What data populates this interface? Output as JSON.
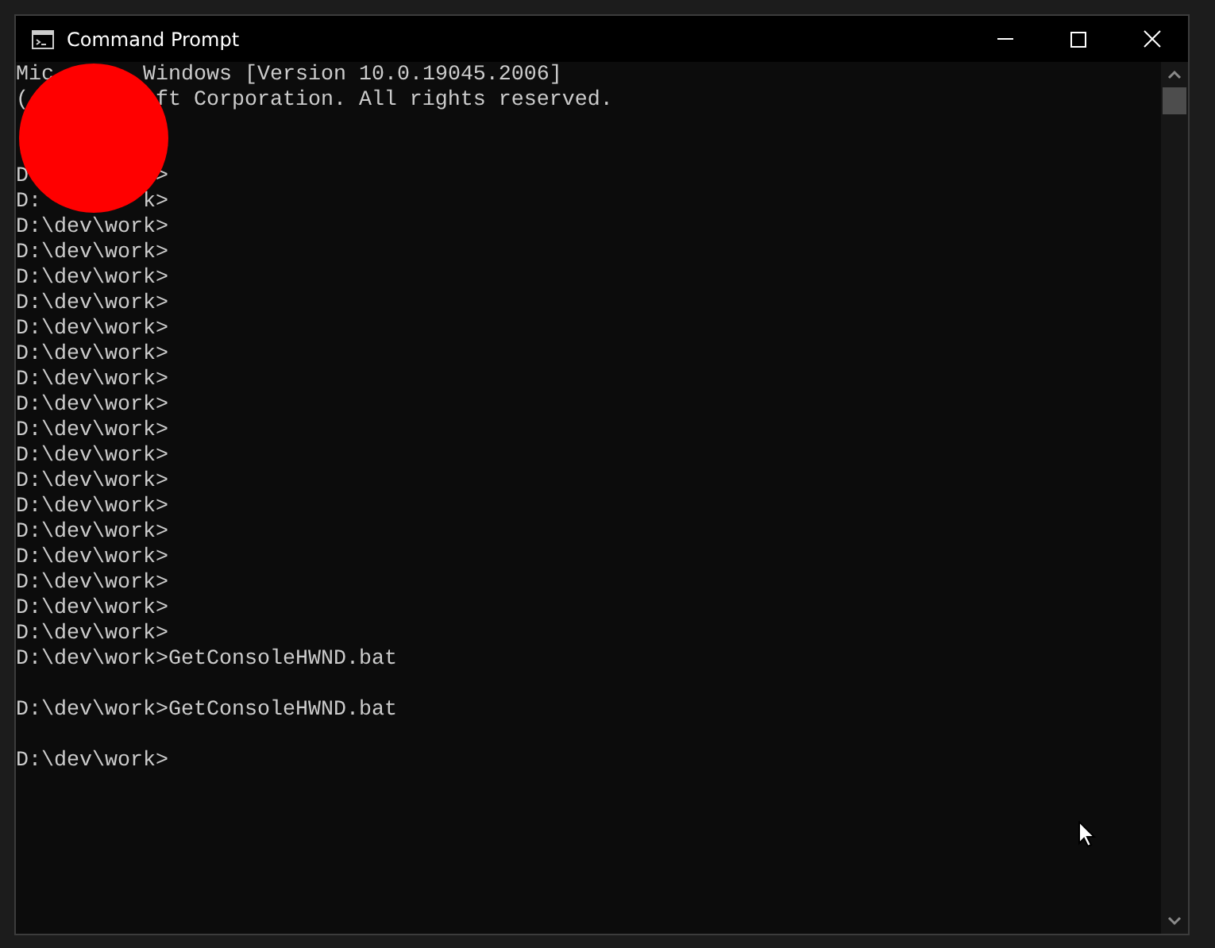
{
  "window": {
    "title": "Command Prompt"
  },
  "console": {
    "lines": [
      {
        "text": "Mic       Windows [Version 10.0.19045.2006]"
      },
      {
        "text": "(          ft Corporation. All rights reserved."
      },
      {
        "kind": "blank"
      },
      {
        "kind": "blank"
      },
      {
        "text": "D          >"
      },
      {
        "text": "D:        k>"
      },
      {
        "text": "D:\\dev\\work>"
      },
      {
        "text": "D:\\dev\\work>"
      },
      {
        "text": "D:\\dev\\work>"
      },
      {
        "text": "D:\\dev\\work>"
      },
      {
        "text": "D:\\dev\\work>"
      },
      {
        "text": "D:\\dev\\work>"
      },
      {
        "text": "D:\\dev\\work>"
      },
      {
        "text": "D:\\dev\\work>"
      },
      {
        "text": "D:\\dev\\work>"
      },
      {
        "text": "D:\\dev\\work>"
      },
      {
        "text": "D:\\dev\\work>"
      },
      {
        "text": "D:\\dev\\work>"
      },
      {
        "text": "D:\\dev\\work>"
      },
      {
        "text": "D:\\dev\\work>"
      },
      {
        "text": "D:\\dev\\work>"
      },
      {
        "text": "D:\\dev\\work>"
      },
      {
        "text": "D:\\dev\\work>"
      },
      {
        "text": "D:\\dev\\work>GetConsoleHWND.bat"
      },
      {
        "kind": "blank"
      },
      {
        "text": "D:\\dev\\work>GetConsoleHWND.bat"
      },
      {
        "kind": "blank"
      },
      {
        "text": "D:\\dev\\work>"
      }
    ]
  }
}
